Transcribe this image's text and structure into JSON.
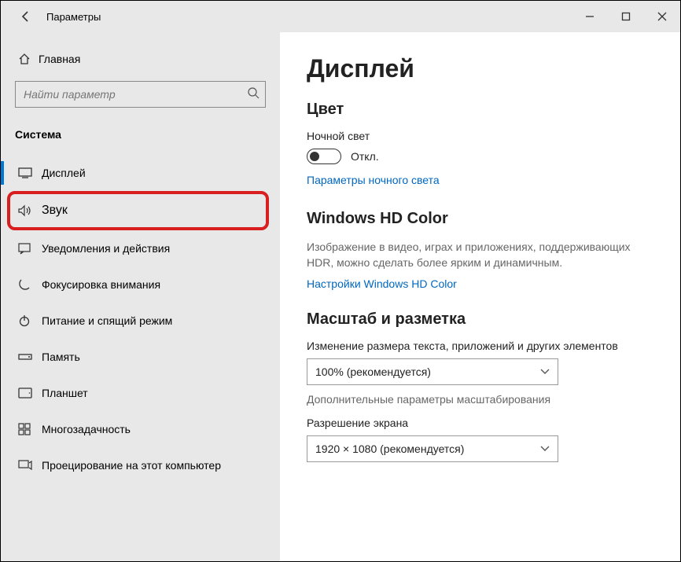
{
  "window": {
    "title": "Параметры"
  },
  "sidebar": {
    "home_label": "Главная",
    "search_placeholder": "Найти параметр",
    "section_label": "Система",
    "items": [
      {
        "label": "Дисплей"
      },
      {
        "label": "Звук"
      },
      {
        "label": "Уведомления и действия"
      },
      {
        "label": "Фокусировка внимания"
      },
      {
        "label": "Питание и спящий режим"
      },
      {
        "label": "Память"
      },
      {
        "label": "Планшет"
      },
      {
        "label": "Многозадачность"
      },
      {
        "label": "Проецирование на этот компьютер"
      }
    ]
  },
  "content": {
    "title": "Дисплей",
    "color_heading": "Цвет",
    "night_light_label": "Ночной свет",
    "toggle_off": "Откл.",
    "night_light_link": "Параметры ночного света",
    "hd_heading": "Windows HD Color",
    "hd_desc": "Изображение в видео, играх и приложениях, поддерживающих HDR, можно сделать более ярким и динамичным.",
    "hd_link": "Настройки Windows HD Color",
    "scale_heading": "Масштаб и разметка",
    "scale_label": "Изменение размера текста, приложений и других элементов",
    "scale_value": "100% (рекомендуется)",
    "advanced_scale_link": "Дополнительные параметры масштабирования",
    "resolution_label": "Разрешение экрана",
    "resolution_value": "1920 × 1080 (рекомендуется)"
  }
}
